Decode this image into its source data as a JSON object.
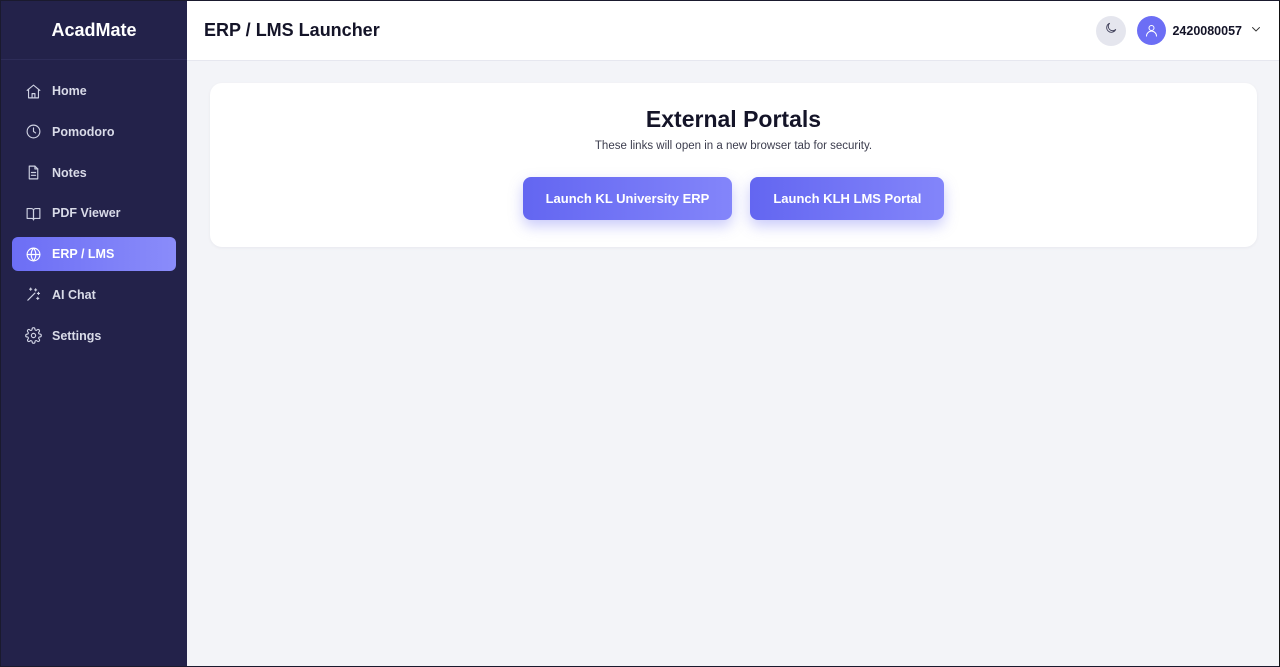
{
  "app": {
    "name": "AcadMate"
  },
  "sidebar": {
    "items": [
      {
        "label": "Home",
        "icon": "home-icon",
        "active": false
      },
      {
        "label": "Pomodoro",
        "icon": "clock-icon",
        "active": false
      },
      {
        "label": "Notes",
        "icon": "document-icon",
        "active": false
      },
      {
        "label": "PDF Viewer",
        "icon": "book-open-icon",
        "active": false
      },
      {
        "label": "ERP / LMS",
        "icon": "globe-icon",
        "active": true
      },
      {
        "label": "AI Chat",
        "icon": "sparkles-icon",
        "active": false
      },
      {
        "label": "Settings",
        "icon": "gear-icon",
        "active": false
      }
    ]
  },
  "header": {
    "title": "ERP / LMS Launcher",
    "theme_toggle_icon": "moon-icon",
    "user_id": "2420080057"
  },
  "main": {
    "card_title": "External Portals",
    "card_subtitle": "These links will open in a new browser tab for security.",
    "buttons": [
      {
        "label": "Launch KL University ERP"
      },
      {
        "label": "Launch KLH LMS Portal"
      }
    ]
  },
  "colors": {
    "sidebar_bg": "#23224a",
    "accent": "#6366f1",
    "page_bg": "#f3f4f8"
  }
}
